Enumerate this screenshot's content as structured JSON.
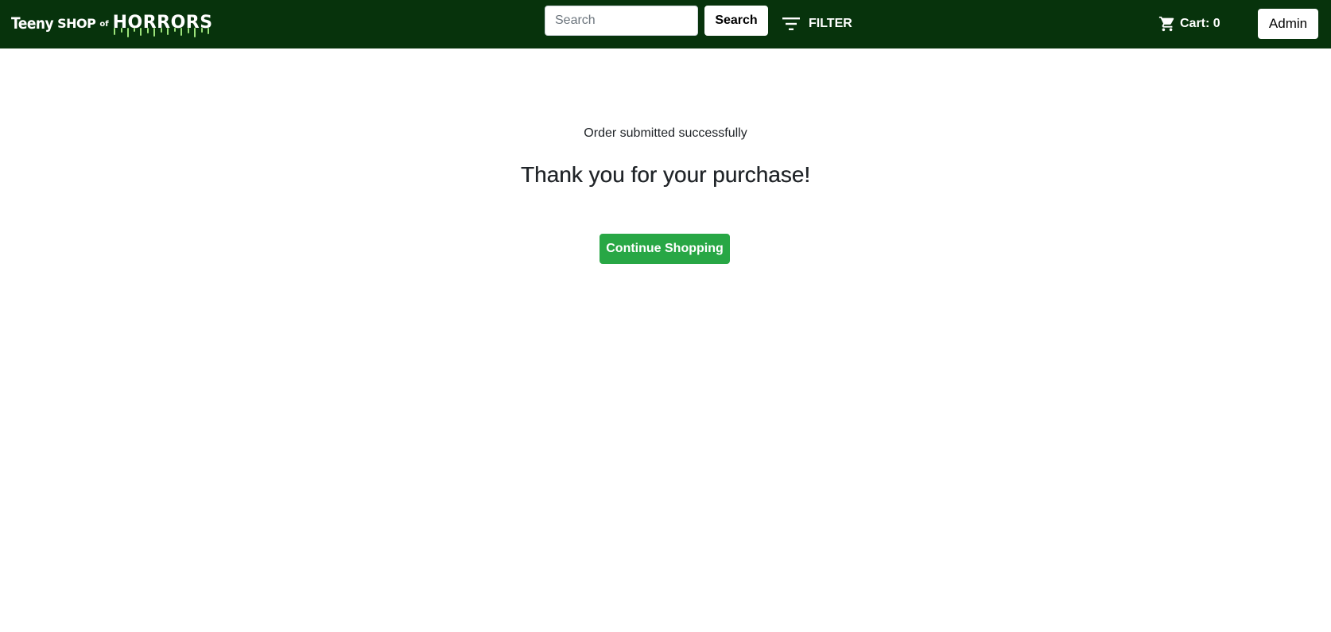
{
  "colors": {
    "navbar_bg": "#07330c",
    "accent_green": "#28a745",
    "text": "#212529",
    "logo_drip": "#9be37a"
  },
  "navbar": {
    "logo": {
      "word_teeny": "Teeny",
      "word_shop": "SHOP",
      "word_of": "of",
      "word_horrors": "HORRORS"
    },
    "search": {
      "placeholder": "Search",
      "value": "",
      "button_label": "Search",
      "icon": "search-icon"
    },
    "filter": {
      "icon": "filter-icon",
      "label": "FILTER"
    },
    "cart": {
      "icon": "cart-icon",
      "label": "Cart: 0"
    },
    "admin_label": "Admin"
  },
  "main": {
    "status_message": "Order submitted successfully",
    "heading": "Thank you for your purchase!",
    "continue_label": "Continue Shopping"
  }
}
